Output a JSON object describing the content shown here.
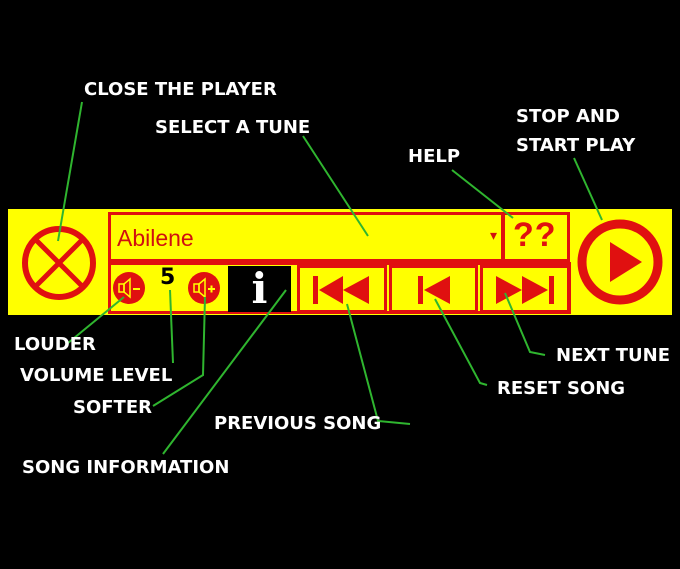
{
  "player": {
    "tune_select": {
      "selected": "Abilene",
      "arrow": "▾"
    },
    "help_label": "??",
    "volume_level": "5",
    "info_label": "i",
    "icons": {
      "close": "close-circle-x-icon",
      "play": "play-icon",
      "louder": "speaker-minus-icon",
      "softer": "speaker-plus-icon",
      "info": "info-icon",
      "previous": "skip-back-icon",
      "reset": "step-back-icon",
      "next": "skip-forward-icon"
    },
    "colors": {
      "panel": "#ffff00",
      "accent": "#e01010",
      "background": "#000000",
      "leader": "#2fb52f"
    }
  },
  "annotations": {
    "close_the_player": "CLOSE THE PLAYER",
    "select_a_tune": "SELECT A TUNE",
    "help": "HELP",
    "stop_and_start_play_1": "STOP AND",
    "stop_and_start_play_2": "START PLAY",
    "louder": "LOUDER",
    "volume_level": "VOLUME LEVEL",
    "softer": "SOFTER",
    "song_information": "SONG INFORMATION",
    "previous_song": "PREVIOUS SONG",
    "next_tune": "NEXT TUNE",
    "reset_song": "RESET SONG"
  }
}
